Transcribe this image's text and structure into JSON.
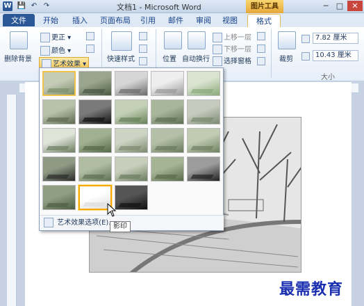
{
  "window": {
    "title": "文档1 - Microsoft Word",
    "contextual_tab_group": "图片工具"
  },
  "quick_access": {
    "save": "💾",
    "undo": "↶",
    "redo": "↷",
    "word_icon": "W"
  },
  "window_controls": {
    "minimize": "─",
    "maximize": "□",
    "close": "✕"
  },
  "tabs": [
    {
      "label": "文件"
    },
    {
      "label": "开始"
    },
    {
      "label": "插入"
    },
    {
      "label": "页面布局"
    },
    {
      "label": "引用"
    },
    {
      "label": "邮件"
    },
    {
      "label": "审阅"
    },
    {
      "label": "视图"
    },
    {
      "label": "格式"
    }
  ],
  "ribbon": {
    "remove_bg": "删除背景",
    "corrections": "更正",
    "color": "颜色",
    "art_effects": "艺术效果",
    "quick_styles": "快速样式",
    "position": "位置",
    "wrap_text": "自动换行",
    "bring_forward": "上移一层",
    "send_backward": "下移一层",
    "selection_pane": "选择窗格",
    "crop": "裁剪",
    "height": "7.82 厘米",
    "width": "10.43 厘米",
    "size_group": "大小"
  },
  "popup": {
    "footer": "艺术效果选项(E)..."
  },
  "tooltip": "影印",
  "watermark": "最需教育"
}
